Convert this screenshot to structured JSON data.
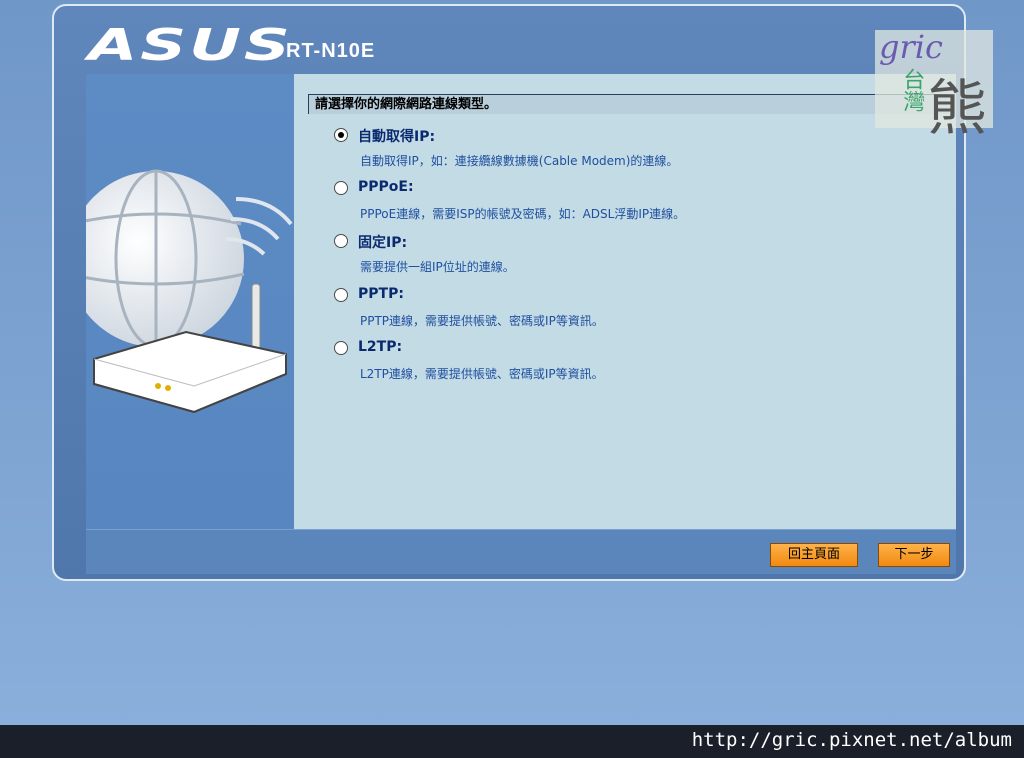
{
  "header": {
    "logo_text": "ASUS",
    "model": "RT-N10E"
  },
  "content": {
    "heading": "請選擇你的網際網路連線類型。",
    "options": [
      {
        "label": "自動取得IP:",
        "desc": "自動取得IP，如：連接纜線數據機(Cable Modem)的連線。",
        "selected": true
      },
      {
        "label": "PPPoE:",
        "desc": "PPPoE連線，需要ISP的帳號及密碼，如：ADSL浮動IP連線。",
        "selected": false
      },
      {
        "label": "固定IP:",
        "desc": "需要提供一組IP位址的連線。",
        "selected": false
      },
      {
        "label": "PPTP:",
        "desc": "PPTP連線，需要提供帳號、密碼或IP等資訊。",
        "selected": false
      },
      {
        "label": "L2TP:",
        "desc": "L2TP連線，需要提供帳號、密碼或IP等資訊。",
        "selected": false
      }
    ]
  },
  "buttons": {
    "home": "回主頁面",
    "next": "下一步"
  },
  "watermark": {
    "brand": "gric",
    "region": "台灣",
    "bear": "熊"
  },
  "footer": {
    "url": "http://gric.pixnet.net/album"
  },
  "colors": {
    "accent_button": "#f59a20",
    "panel": "#5f87bb",
    "content_bg": "#c3dbe4"
  }
}
